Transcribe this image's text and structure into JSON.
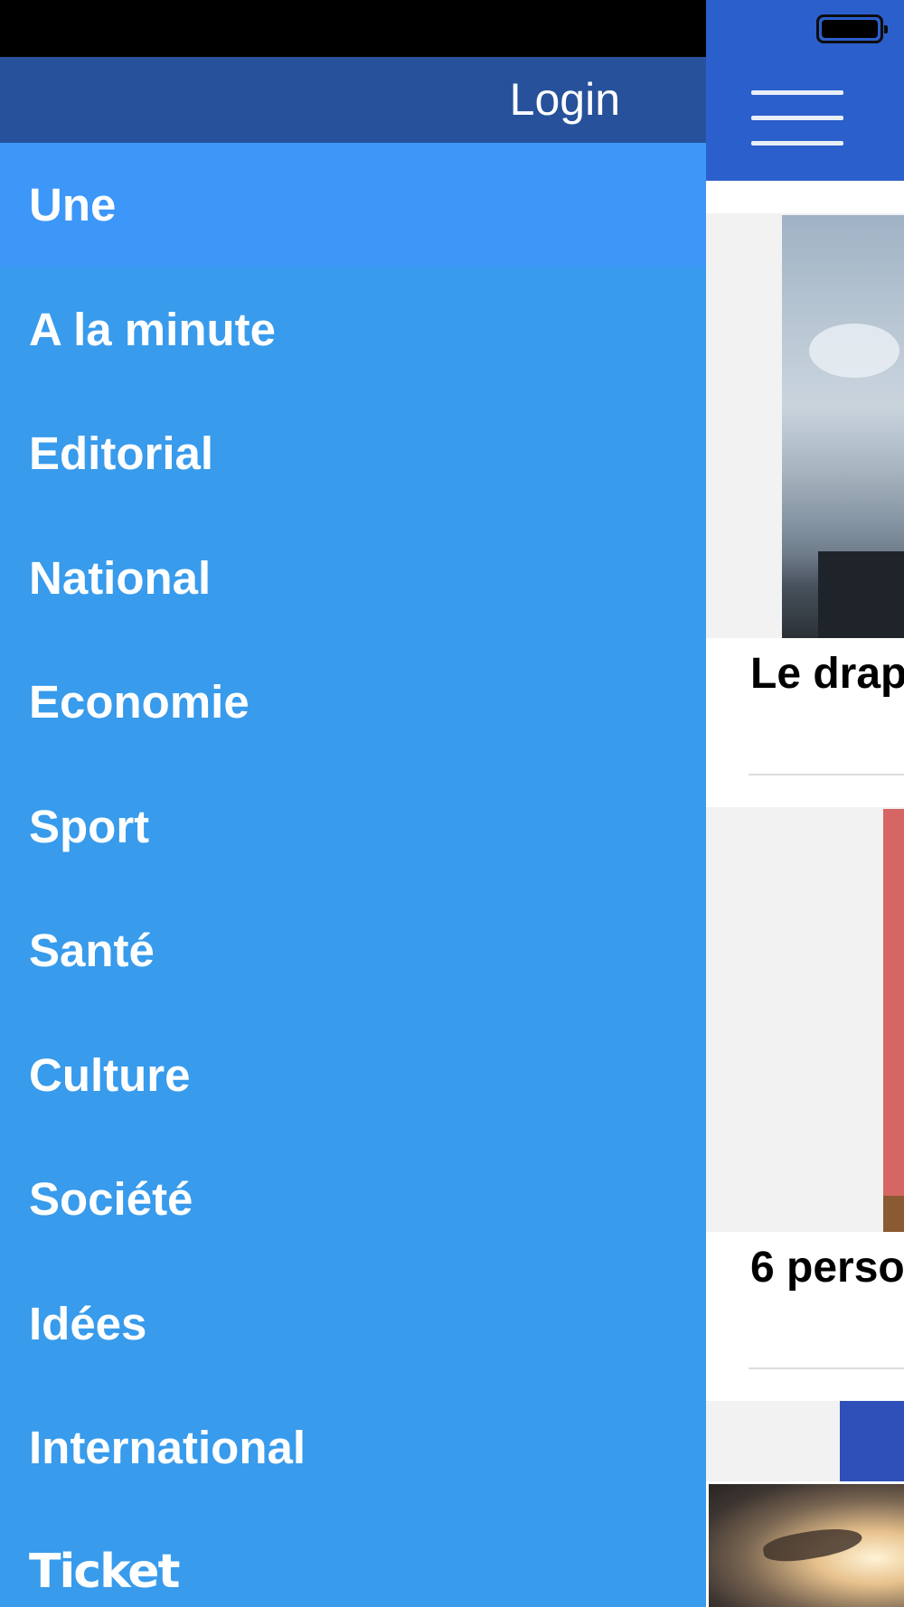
{
  "drawer": {
    "login_label": "Login",
    "menu_items": [
      {
        "label": "Une"
      },
      {
        "label": "A la minute"
      },
      {
        "label": "Editorial"
      },
      {
        "label": "National"
      },
      {
        "label": "Economie"
      },
      {
        "label": "Sport"
      },
      {
        "label": "Santé"
      },
      {
        "label": "Culture"
      },
      {
        "label": "Société"
      },
      {
        "label": "Idées"
      },
      {
        "label": "International"
      },
      {
        "label": "Ticket"
      }
    ],
    "active_item": "Une"
  },
  "main": {
    "articles": [
      {
        "title_visible": "Le drap"
      },
      {
        "title_visible": "6 perso"
      }
    ]
  },
  "colors": {
    "drawer_bg": "#389BEC",
    "drawer_active": "#3D97F8",
    "drawer_header": "#27519A",
    "main_header": "#2B5FCB"
  },
  "icons": [
    "hamburger-icon",
    "battery-icon"
  ]
}
